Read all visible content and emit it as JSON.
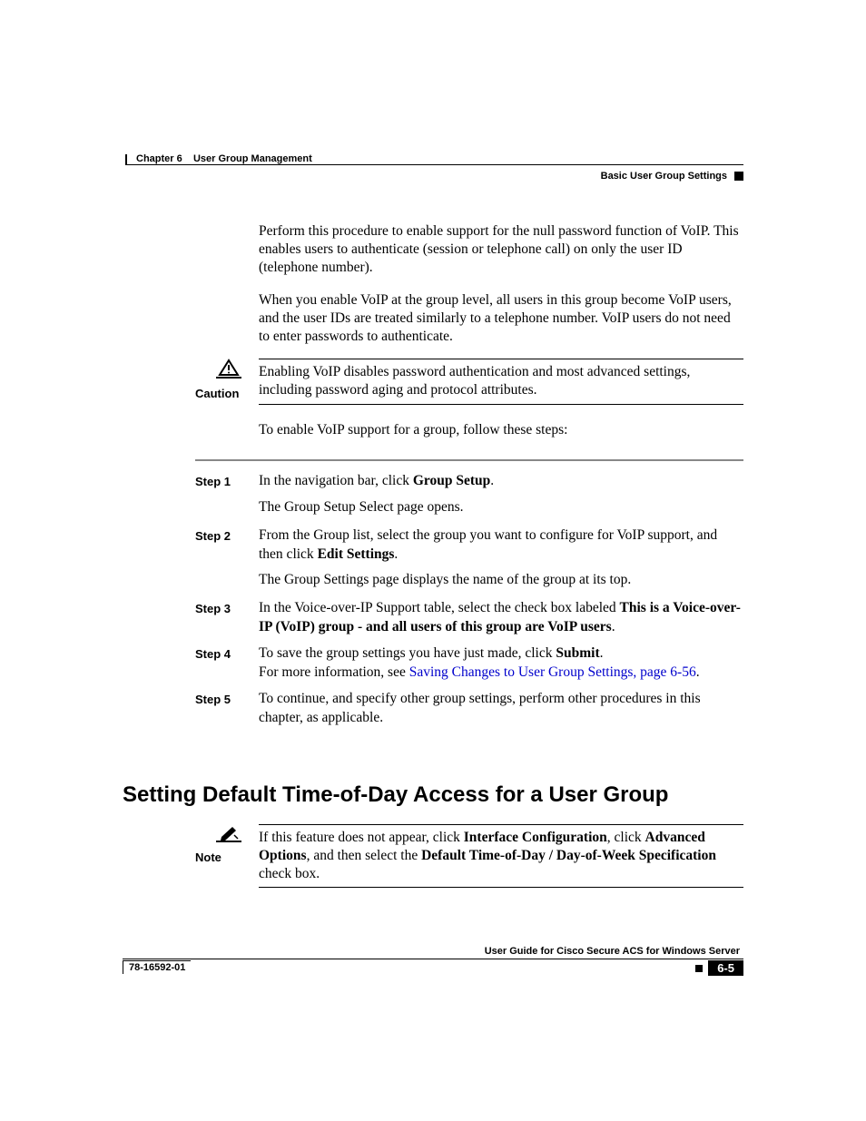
{
  "header": {
    "chapter": "Chapter 6",
    "chapterTitle": "User Group Management",
    "sectionRight": "Basic User Group Settings"
  },
  "intro": {
    "p1": "Perform this procedure to enable support for the null password function of VoIP. This enables users to authenticate (session or telephone call) on only the user ID (telephone number).",
    "p2": "When you enable VoIP at the group level, all users in this group become VoIP users, and the user IDs are treated similarly to a telephone number. VoIP users do not need to enter passwords to authenticate."
  },
  "caution": {
    "label": "Caution",
    "text": "Enabling VoIP disables password authentication and most advanced settings, including password aging and protocol attributes."
  },
  "lead": "To enable VoIP support for a group, follow these steps:",
  "steps": [
    {
      "label": "Step 1",
      "parts": {
        "pre": "In the navigation bar, click ",
        "b1": "Group Setup",
        "post": "."
      },
      "sub": "The Group Setup Select page opens."
    },
    {
      "label": "Step 2",
      "parts": {
        "pre": "From the Group list, select the group you want to configure for VoIP support, and then click ",
        "b1": "Edit Settings",
        "post": "."
      },
      "sub": "The Group Settings page displays the name of the group at its top."
    },
    {
      "label": "Step 3",
      "parts": {
        "pre": "In the Voice-over-IP Support table, select the check box labeled ",
        "b1": "This is a Voice-over-IP (VoIP) group - and all users of this group are VoIP users",
        "post": "."
      }
    },
    {
      "label": "Step 4",
      "parts": {
        "pre": "To save the group settings you have just made, click ",
        "b1": "Submit",
        "post": "."
      },
      "line2pre": "For more information, see ",
      "link": "Saving Changes to User Group Settings, page 6-56",
      "line2post": "."
    },
    {
      "label": "Step 5",
      "plain": "To continue, and specify other group settings, perform other procedures in this chapter, as applicable."
    }
  ],
  "heading": "Setting Default Time-of-Day Access for a User Group",
  "note": {
    "label": "Note",
    "pre": "If this feature does not appear, click ",
    "b1": "Interface Configuration",
    "mid1": ", click ",
    "b2": "Advanced Options",
    "mid2": ", and then select the ",
    "b3": "Default Time-of-Day / Day-of-Week Specification",
    "post": " check box."
  },
  "footer": {
    "title": "User Guide for Cisco Secure ACS for Windows Server",
    "docnum": "78-16592-01",
    "pagenum": "6-5"
  }
}
